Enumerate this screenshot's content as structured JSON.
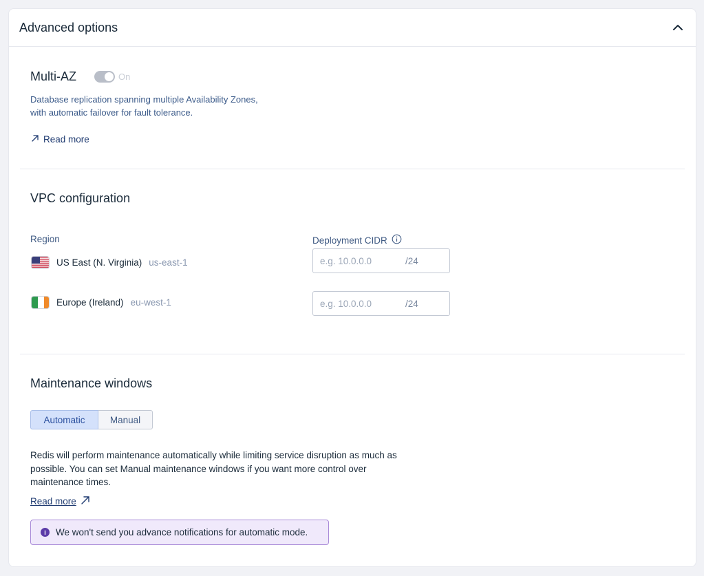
{
  "header": {
    "title": "Advanced options",
    "icon": "chevron-up-icon"
  },
  "multi_az": {
    "title": "Multi-AZ",
    "toggle_label": "On",
    "toggle_on": true,
    "toggle_disabled": true,
    "description": "Database replication spanning multiple Availability Zones, with automatic failover for fault tolerance.",
    "read_more": "Read more"
  },
  "vpc": {
    "title": "VPC configuration",
    "region_header": "Region",
    "cidr_header": "Deployment CIDR",
    "rows": [
      {
        "flag": "us-flag-icon",
        "name": "US East (N. Virginia)",
        "code": "us-east-1",
        "cidr_placeholder": "e.g. 10.0.0.0",
        "cidr_value": "",
        "suffix": "/24"
      },
      {
        "flag": "ireland-flag-icon",
        "name": "Europe (Ireland)",
        "code": "eu-west-1",
        "cidr_placeholder": "e.g. 10.0.0.0",
        "cidr_value": "",
        "suffix": "/24"
      }
    ]
  },
  "maintenance": {
    "title": "Maintenance windows",
    "tabs": [
      {
        "label": "Automatic",
        "selected": true
      },
      {
        "label": "Manual",
        "selected": false
      }
    ],
    "description": "Redis will perform maintenance automatically while limiting service disruption as much as possible. You can set Manual maintenance windows if you want more control over maintenance times.",
    "read_more": "Read more",
    "notice": "We won't send you advance notifications for automatic mode."
  },
  "colors": {
    "accent": "#2a4f9e",
    "notice_bg": "#f0e9fb",
    "notice_border": "#a98ad8",
    "toggle_disabled": "#b9bec8"
  }
}
